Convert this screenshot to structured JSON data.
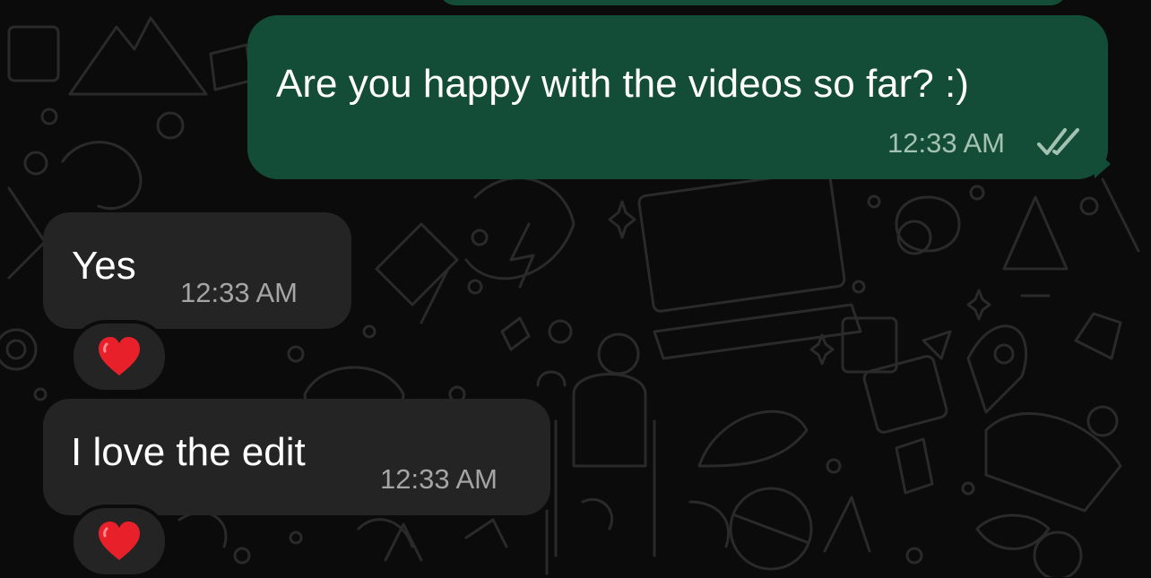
{
  "colors": {
    "background": "#0b0b0b",
    "outgoing_bubble": "#144d37",
    "incoming_bubble": "#242424",
    "read_receipt": "#a3c2b4",
    "reaction_heart": "#e8202a"
  },
  "messages": [
    {
      "direction": "outgoing",
      "text": "Are you happy with the videos so far? :)",
      "time": "12:33 AM",
      "status_icon": "double-check-icon"
    },
    {
      "direction": "incoming",
      "text": "Yes",
      "time": "12:33 AM",
      "reaction_icon": "red-heart-icon"
    },
    {
      "direction": "incoming",
      "text": "I love the edit",
      "time": "12:33 AM",
      "reaction_icon": "red-heart-icon"
    }
  ]
}
